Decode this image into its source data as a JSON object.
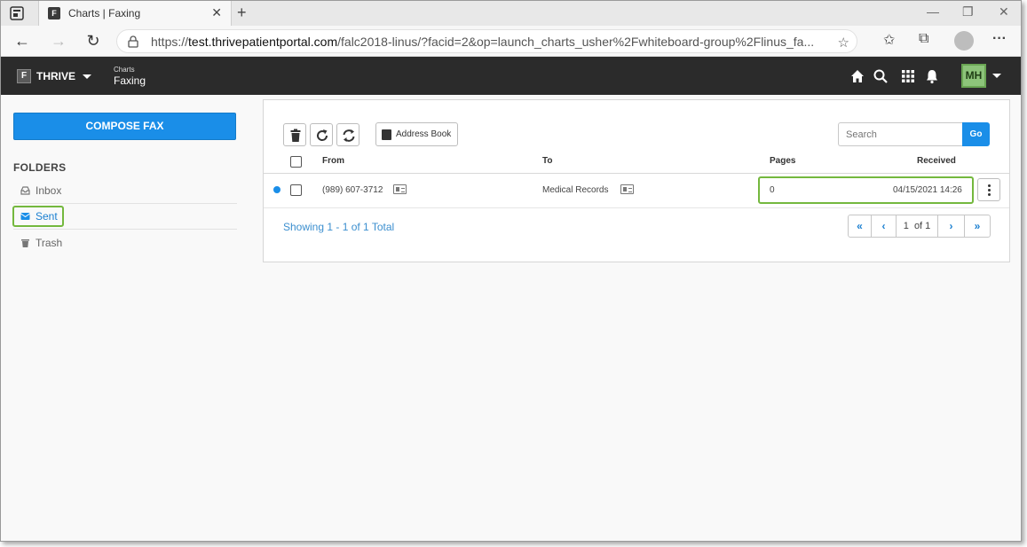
{
  "browser": {
    "tab_title": "Charts | Faxing",
    "tab_favicon": "F",
    "url_prefix": "https://",
    "url_host": "test.thrivepatientportal.com",
    "url_path": "/falc2018-linus/?facid=2&op=launch_charts_usher%2Fwhiteboard-group%2Flinus_fa..."
  },
  "app": {
    "brand": "THRIVE",
    "logo_letter": "F",
    "crumb_small": "Charts",
    "crumb_big": "Faxing",
    "user_initials": "MH",
    "accent": "#1a8ee8",
    "highlight": "#74b83e"
  },
  "sidebar": {
    "compose_label": "COMPOSE FAX",
    "folders_label": "FOLDERS",
    "items": [
      {
        "label": "Inbox",
        "icon": "inbox-icon"
      },
      {
        "label": "Sent",
        "icon": "envelope-icon"
      },
      {
        "label": "Trash",
        "icon": "trash-icon"
      }
    ]
  },
  "toolbar": {
    "address_book_label": "Address Book",
    "search_placeholder": "Search",
    "go_label": "Go"
  },
  "table": {
    "headers": {
      "from": "From",
      "to": "To",
      "pages": "Pages",
      "received": "Received"
    },
    "rows": [
      {
        "from": "(989) 607-3712",
        "to": "Medical Records",
        "pages": "0",
        "received": "04/15/2021 14:26",
        "unread": true
      }
    ]
  },
  "pagination": {
    "showing": "Showing 1 - 1 of 1 Total",
    "page": "1",
    "of": "of 1"
  }
}
